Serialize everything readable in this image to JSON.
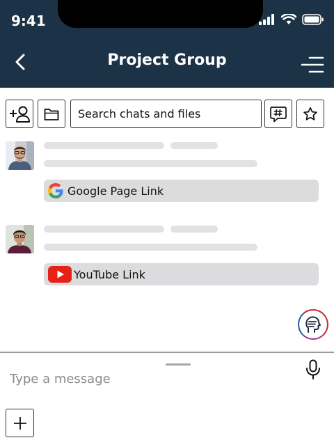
{
  "status_bar": {
    "time": "9:41"
  },
  "header": {
    "title": "Project Group"
  },
  "toolbar": {
    "search_placeholder": "Search chats and files"
  },
  "messages": [
    {
      "link": {
        "label": "Google Page Link",
        "icon": "google-icon"
      }
    },
    {
      "link": {
        "label": "YouTube Link",
        "icon": "youtube-icon"
      }
    }
  ],
  "composer": {
    "placeholder": "Type a message"
  },
  "colors": {
    "header_bg": "#1c3246",
    "youtube_red": "#e62117",
    "skeleton": "#e2e2e2",
    "link_card": "#dcdcdf"
  }
}
